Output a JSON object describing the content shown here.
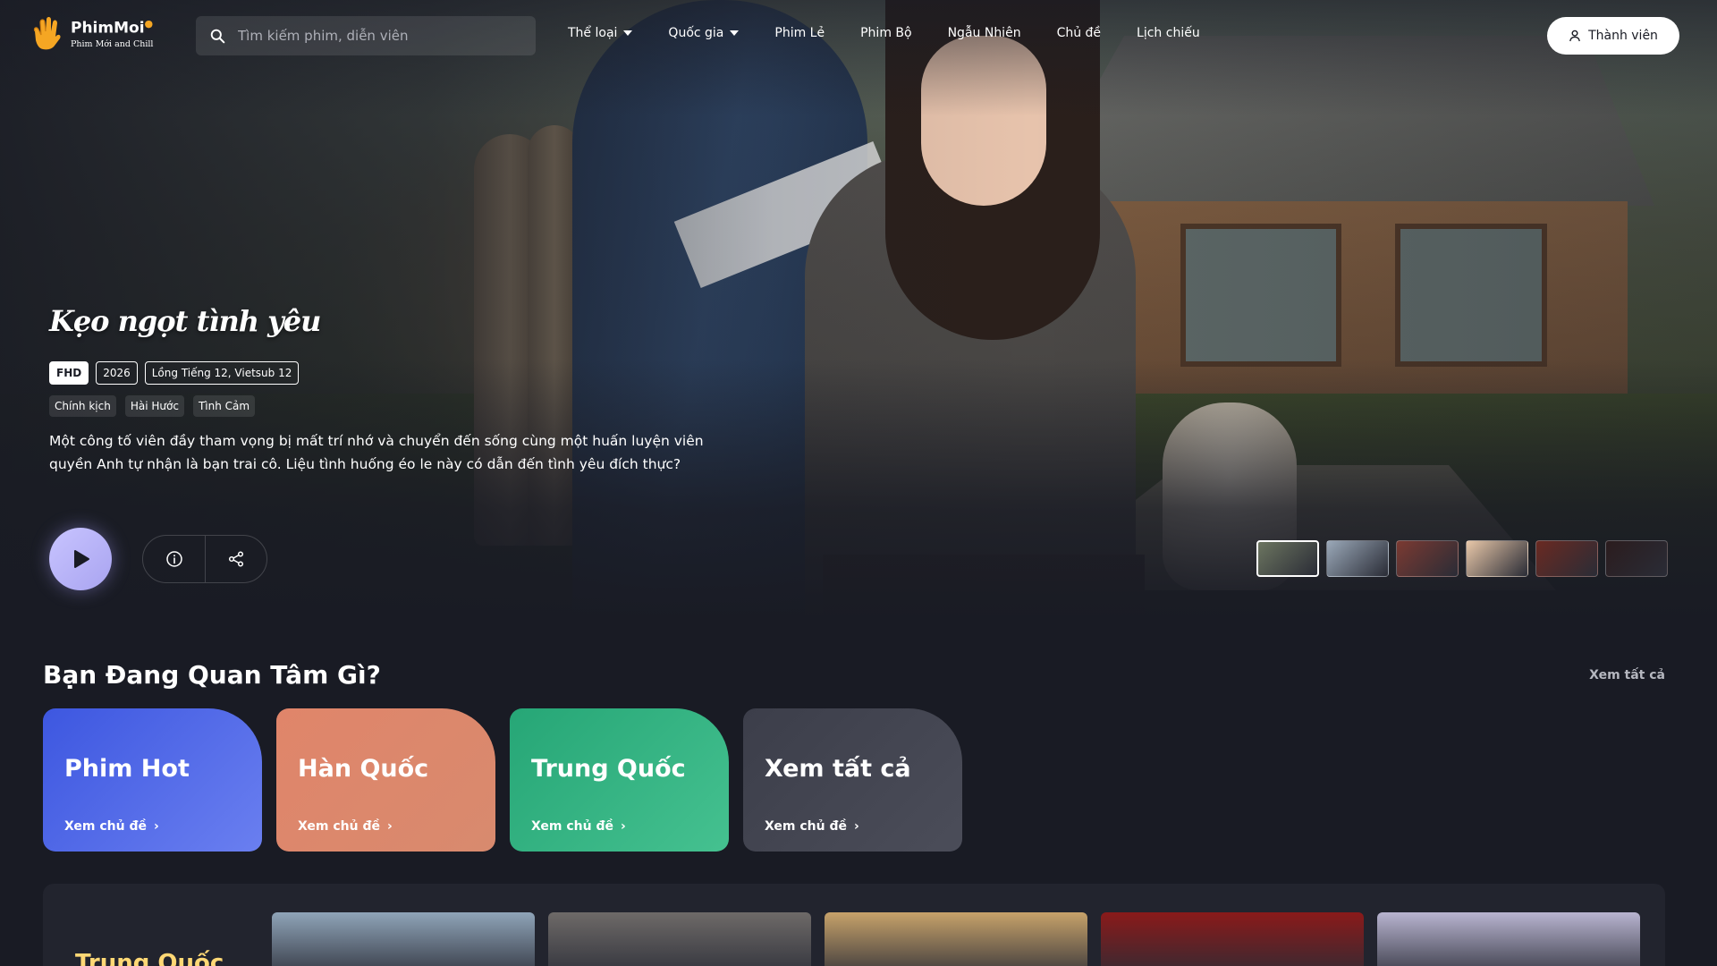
{
  "header": {
    "logo": {
      "name": "PhimMoi",
      "tagline": "Phim Mới and Chill"
    },
    "search": {
      "placeholder": "Tìm kiếm phim, diễn viên"
    },
    "nav": [
      {
        "label": "Thể loại",
        "has_dropdown": true
      },
      {
        "label": "Quốc gia",
        "has_dropdown": true
      },
      {
        "label": "Phim Lẻ"
      },
      {
        "label": "Phim Bộ"
      },
      {
        "label": "Ngẫu Nhiên"
      },
      {
        "label": "Chủ đề"
      },
      {
        "label": "Lịch chiếu"
      }
    ],
    "member_label": "Thành viên"
  },
  "hero": {
    "title": "Kẹo ngọt tình yêu",
    "badges": [
      "FHD",
      "2026",
      "Lồng Tiếng 12, Vietsub 12"
    ],
    "genres": [
      "Chính kịch",
      "Hài Hước",
      "Tình Cảm"
    ],
    "description": "Một công tố viên đầy tham vọng bị mất trí nhớ và chuyển đến sống cùng một huấn luyện viên quyền Anh tự nhận là bạn trai cô. Liệu tình huống éo le này có dẫn đến tình yêu đích thực?",
    "thumbnails": [
      {
        "name": "thumb-1",
        "color": "#6c7560",
        "active": true
      },
      {
        "name": "thumb-2",
        "color": "#9aa8b8"
      },
      {
        "name": "thumb-3",
        "color": "#7b3a32"
      },
      {
        "name": "thumb-4",
        "color": "#e8c7a8"
      },
      {
        "name": "thumb-5",
        "color": "#6a2a22"
      },
      {
        "name": "thumb-6",
        "color": "#2b1c1e"
      }
    ]
  },
  "topics": {
    "title": "Bạn Đang Quan Tâm Gì?",
    "view_all": "Xem tất cả",
    "cards": [
      {
        "title": "Phim Hot",
        "link": "Xem chủ đề",
        "color_from": "#3d57e0",
        "color_to": "#6a7ff0"
      },
      {
        "title": "Hàn Quốc",
        "link": "Xem chủ đề",
        "color_from": "#e0856a",
        "color_to": "#d88a6e"
      },
      {
        "title": "Trung Quốc",
        "link": "Xem chủ đề",
        "color_from": "#26a676",
        "color_to": "#45c190"
      },
      {
        "title": "Xem tất cả",
        "link": "Xem chủ đề",
        "color_from": "#3c3e4a",
        "color_to": "#4b4d59"
      }
    ]
  },
  "bottom": {
    "label": "Trung Quốc",
    "posters": [
      "#8fa4b8",
      "#6e6a68",
      "#c7a26a",
      "#8a1a1a",
      "#b8b4d0"
    ]
  },
  "colors": {
    "background": "#191b24",
    "accent": "#ffd875"
  }
}
